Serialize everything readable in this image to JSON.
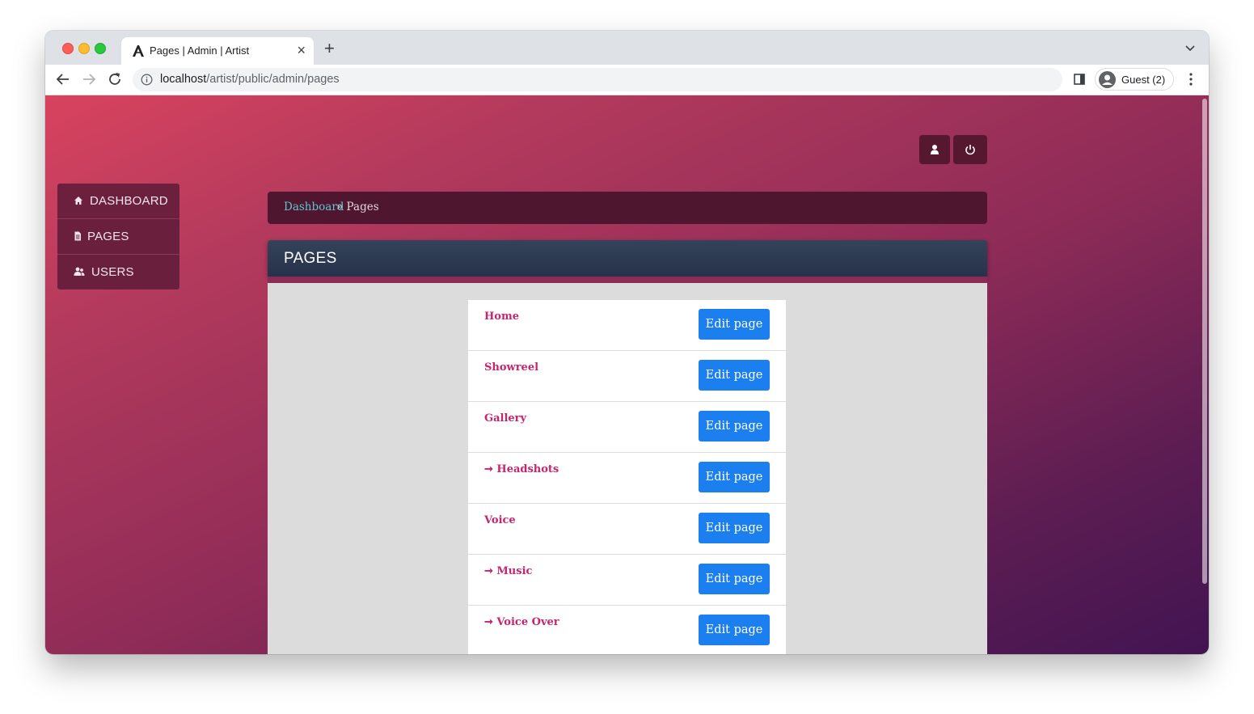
{
  "browser": {
    "tab_title": "Pages | Admin | Artist",
    "tab_close": "×",
    "new_tab": "+",
    "url_host": "localhost",
    "url_path": "/artist/public/admin/pages",
    "profile_label": "Guest (2)"
  },
  "header": {
    "account_icon": "user-icon",
    "logout_icon": "power-icon"
  },
  "sidebar": {
    "items": [
      {
        "label": "DASHBOARD",
        "icon": "home-icon"
      },
      {
        "label": "PAGES",
        "icon": "document-icon"
      },
      {
        "label": "USERS",
        "icon": "users-icon"
      }
    ]
  },
  "breadcrumb": {
    "link": "Dashboard",
    "current": "» Pages"
  },
  "panel": {
    "title": "PAGES"
  },
  "pages": {
    "items": [
      {
        "name": "Home",
        "button": "Edit page"
      },
      {
        "name": "Showreel",
        "button": "Edit page"
      },
      {
        "name": "Gallery",
        "button": "Edit page"
      },
      {
        "name": "➞ Headshots",
        "button": "Edit page"
      },
      {
        "name": "Voice",
        "button": "Edit page"
      },
      {
        "name": "➞ Music",
        "button": "Edit page"
      },
      {
        "name": "➞ Voice Over",
        "button": "Edit page"
      }
    ]
  },
  "colors": {
    "accent_link": "#c8246e",
    "button": "#1c7ff0",
    "breadcrumb_link": "#5fc6c9"
  }
}
